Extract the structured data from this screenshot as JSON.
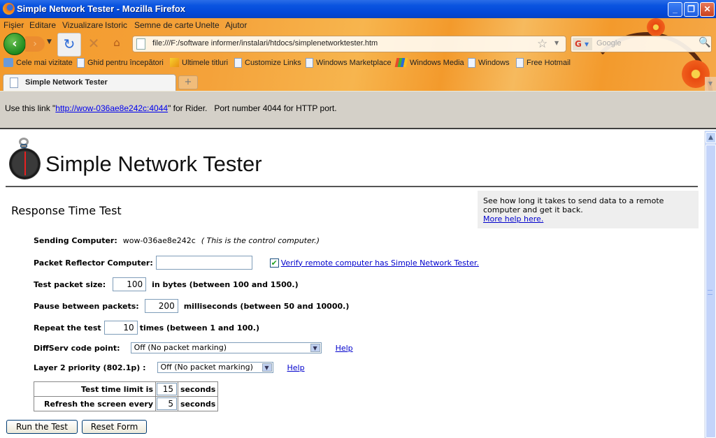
{
  "window": {
    "title": "Simple Network Tester - Mozilla Firefox",
    "minimize": "_",
    "maximize": "❐",
    "close": "✕"
  },
  "menu": [
    "Fişier",
    "Editare",
    "Vizualizare",
    "Istoric",
    "Semne de carte",
    "Unelte",
    "Ajutor"
  ],
  "nav": {
    "url": "file:///F:/software informer/instalari/htdocs/simplenetworktester.htm",
    "search_placeholder": "Google",
    "search_engine": "G"
  },
  "bookmarks": [
    {
      "label": "Cele mai vizitate",
      "icon": "smart-folder-icon"
    },
    {
      "label": "Ghid pentru începători",
      "icon": "page-icon"
    },
    {
      "label": "Ultimele titluri",
      "icon": "rss-icon"
    },
    {
      "label": "Customize Links",
      "icon": "page-icon"
    },
    {
      "label": "Windows Marketplace",
      "icon": "page-icon"
    },
    {
      "label": "Windows Media",
      "icon": "windows-icon"
    },
    {
      "label": "Windows",
      "icon": "page-icon"
    },
    {
      "label": "Free Hotmail",
      "icon": "page-icon"
    }
  ],
  "tabs": [
    {
      "label": "Simple Network Tester",
      "active": true
    }
  ],
  "notice": {
    "prefix": "Use this link \"",
    "link": "http://wow-036ae8e242c:4044",
    "suffix": "\" for Rider.   Port number 4044 for HTTP port."
  },
  "page": {
    "app_title": "Simple Network Tester",
    "section_title": "Response Time Test",
    "help_box": {
      "text": "See how long it takes to send data to a remote computer and get it back.",
      "link": "More help here."
    },
    "sending": {
      "label": "Sending Computer:",
      "value": "wow-036ae8e242c",
      "note": "( This is the control computer.)"
    },
    "reflector": {
      "label": "Packet Reflector Computer:",
      "value": "",
      "verify_checked": true,
      "verify_label": "Verify remote computer has Simple Network Tester."
    },
    "packet_size": {
      "label": "Test packet size:",
      "value": "100",
      "suffix": "in bytes (between 100 and 1500.)"
    },
    "pause": {
      "label": "Pause between packets:",
      "value": "200",
      "suffix": "milliseconds (between 50 and 10000.)"
    },
    "repeat": {
      "label": "Repeat the test",
      "value": "10",
      "suffix": "times (between 1 and 100.)"
    },
    "diffserv": {
      "label": "DiffServ code point:",
      "selected": "Off (No packet marking)",
      "help": "Help"
    },
    "layer2": {
      "label": "Layer 2 priority (802.1p) :",
      "selected": "Off (No packet marking)",
      "help": "Help"
    },
    "limits": [
      {
        "label": "Test time limit is",
        "value": "15",
        "unit": "seconds"
      },
      {
        "label": "Refresh the screen every",
        "value": "5",
        "unit": "seconds"
      }
    ],
    "buttons": {
      "run": "Run the Test",
      "reset": "Reset Form"
    }
  }
}
